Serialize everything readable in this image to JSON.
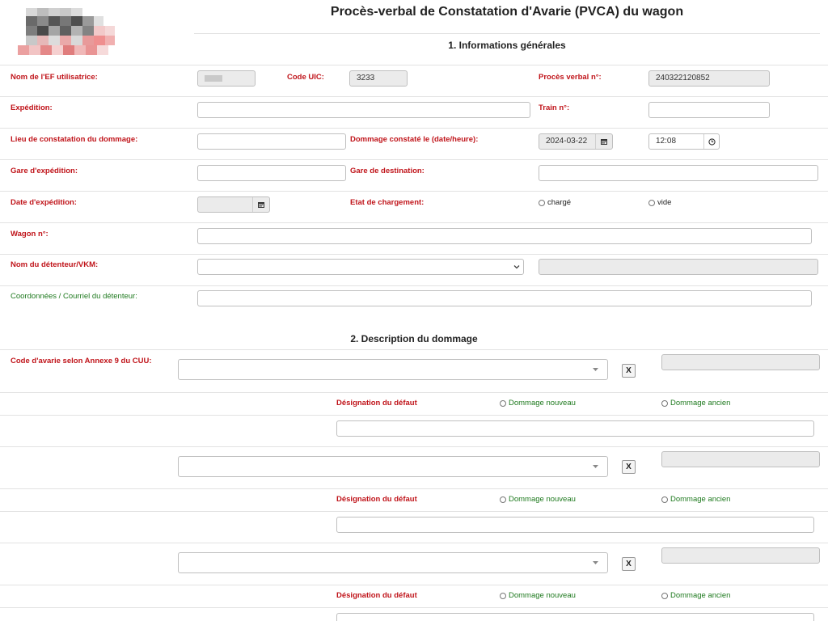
{
  "header": {
    "title": "Procès-verbal de Constatation d'Avarie (PVCA) du wagon"
  },
  "sections": {
    "general": "1. Informations générales",
    "damage": "2. Description du dommage"
  },
  "fields": {
    "ef_label": "Nom de l'EF utilisatrice:",
    "ef_value": "",
    "uic_label": "Code UIC:",
    "uic_value": "3233",
    "pv_label": "Procès verbal n°:",
    "pv_value": "240322120852",
    "expedition_label": "Expédition:",
    "expedition_value": "",
    "train_label": "Train n°:",
    "train_value": "",
    "lieu_label": "Lieu de constatation du dommage:",
    "lieu_value": "",
    "dommage_date_label": "Dommage constaté le (date/heure):",
    "dommage_date_value": "2024-03-22",
    "dommage_time_value": "12:08",
    "gare_exp_label": "Gare d'expédition:",
    "gare_exp_value": "",
    "gare_dest_label": "Gare de destination:",
    "gare_dest_value": "",
    "date_exp_label": "Date d'expédition:",
    "date_exp_value": "",
    "etat_label": "Etat de chargement:",
    "etat_charge": "chargé",
    "etat_vide": "vide",
    "wagon_label": "Wagon n°:",
    "wagon_value": "",
    "detenteur_label": "Nom du détenteur/VKM:",
    "detenteur_value": "",
    "coord_label": "Coordonnées / Courriel du détenteur:",
    "coord_value": ""
  },
  "damage": {
    "code_label": "Code d'avarie selon Annexe 9 du CUU:",
    "remove_label": "X",
    "designation_label": "Désignation du défaut",
    "nouveau_label": "Dommage nouveau",
    "ancien_label": "Dommage ancien"
  },
  "colors": {
    "label_red": "#c0141a",
    "label_green": "#1f7a1f",
    "readonly_bg": "#ebebeb"
  }
}
